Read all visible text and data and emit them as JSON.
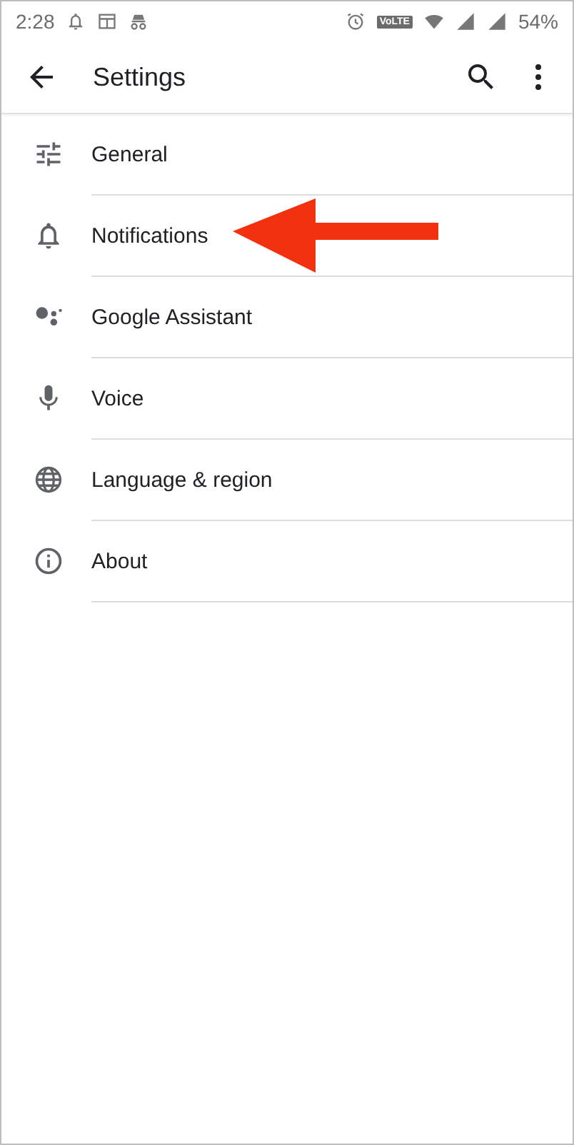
{
  "status_bar": {
    "time": "2:28",
    "network_badge": "VoLTE",
    "battery": "54%"
  },
  "app_bar": {
    "title": "Settings"
  },
  "items": [
    {
      "label": "General",
      "kind": "sliders"
    },
    {
      "label": "Notifications",
      "kind": "bell",
      "annotated": true
    },
    {
      "label": "Google Assistant",
      "kind": "assistant"
    },
    {
      "label": "Voice",
      "kind": "mic"
    },
    {
      "label": "Language & region",
      "kind": "globe"
    },
    {
      "label": "About",
      "kind": "info"
    }
  ]
}
